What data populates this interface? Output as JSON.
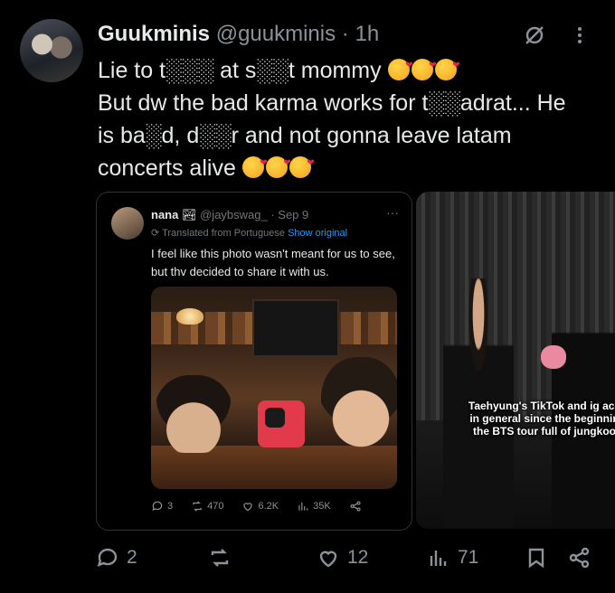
{
  "tweet": {
    "author_name": "Guukminis",
    "handle": "@guukminis",
    "dot": "·",
    "time": "1h",
    "lines": [
      "Lie to t░░░ at s░░t mommy",
      "But dw the bad karma works for t░░adrat... He is ba░d, d░░r and not gonna leave latam concerts alive"
    ],
    "line1_emojis": 3,
    "line2_emojis": 3,
    "header_icons": [
      "grok-icon",
      "more-icon"
    ]
  },
  "quote": {
    "name": "nana",
    "name_badge": "🏞",
    "handle": "@jaybswag_ · Sep 9",
    "more": "···",
    "translated_label": "Translated from Portuguese",
    "show_original": "Show original",
    "text": "I feel like this photo wasn't meant for us to see, but thv decided to share it with us.",
    "actions": {
      "replies": "3",
      "reposts": "470",
      "likes": "6.2K",
      "views": "35K"
    }
  },
  "video": {
    "caption": "Taehyung's TikTok and ig acc\nin general since the beginnin\nthe BTS tour full of jungkoo"
  },
  "actions": {
    "replies": "2",
    "reposts": "",
    "likes": "12",
    "views": "71"
  },
  "colors": {
    "background": "#000000",
    "text": "#e7e9ea",
    "muted": "#8b9298",
    "link": "#1d9bf0",
    "border": "#2f3336"
  }
}
